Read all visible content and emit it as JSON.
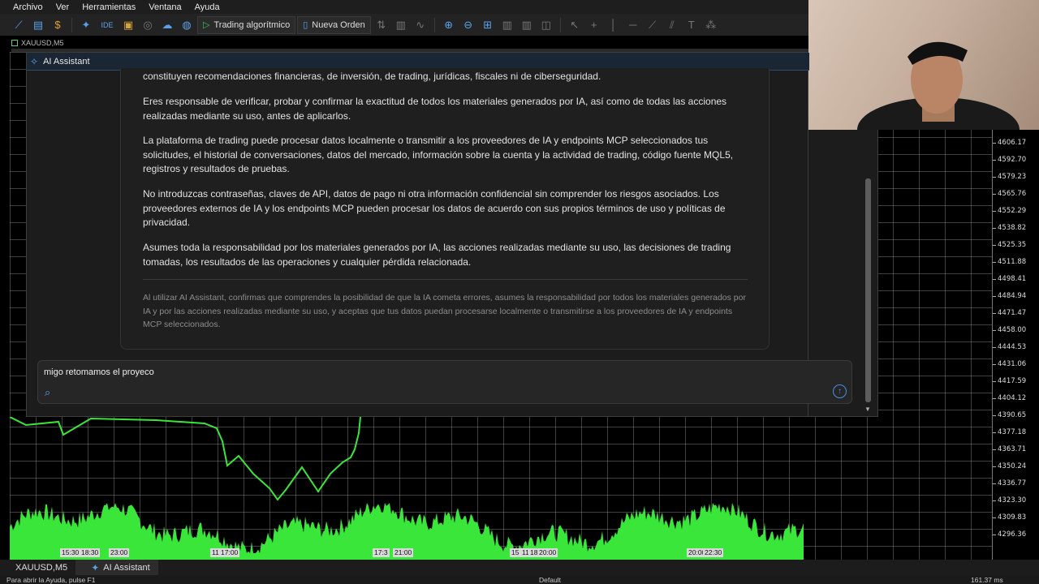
{
  "menu": [
    "Archivo",
    "Ver",
    "Herramientas",
    "Ventana",
    "Ayuda"
  ],
  "toolbar": {
    "algo_trading_label": "Trading algorítmico",
    "new_order_label": "Nueva Orden",
    "ide_label": "IDE"
  },
  "chart": {
    "symbol_tab": "XAUUSD,M5",
    "prices": [
      "4606.17",
      "4592.70",
      "4579.23",
      "4565.76",
      "4552.29",
      "4538.82",
      "4525.35",
      "4511.88",
      "4498.41",
      "4484.94",
      "4471.47",
      "4458.00",
      "4444.53",
      "4431.06",
      "4417.59",
      "4404.12",
      "4390.65",
      "4377.18",
      "4363.71",
      "4350.24",
      "4336.77",
      "4323.30",
      "4309.83",
      "4296.36"
    ],
    "time_labels": [
      "15:30",
      "18:30",
      "23:00",
      "11",
      "17:00",
      "17:3",
      "21:00",
      "15",
      "11",
      "18",
      "20:00",
      "20:00",
      "22:30"
    ]
  },
  "ai_assistant": {
    "title": "AI Assistant",
    "paragraphs": [
      "constituyen recomendaciones financieras, de inversión, de trading, jurídicas, fiscales ni de ciberseguridad.",
      "Eres responsable de verificar, probar y confirmar la exactitud de todos los materiales generados por IA, así como de todas las acciones realizadas mediante su uso, antes de aplicarlos.",
      "La plataforma de trading puede procesar datos localmente o transmitir a los proveedores de IA y endpoints MCP seleccionados tus solicitudes, el historial de conversaciones, datos del mercado, información sobre la cuenta y la actividad de trading, código fuente MQL5, registros y resultados de pruebas.",
      "No introduzcas contraseñas, claves de API, datos de pago ni otra información confidencial sin comprender los riesgos asociados. Los proveedores externos de IA y los endpoints MCP pueden procesar los datos de acuerdo con sus propios términos de uso y políticas de privacidad.",
      "Asumes toda la responsabilidad por los materiales generados por IA, las acciones realizadas mediante su uso, las decisiones de trading tomadas, los resultados de las operaciones y cualquier pérdida relacionada."
    ],
    "note": "Al utilizar AI Assistant, confirmas que comprendes la posibilidad de que la IA cometa errores, asumes la responsabilidad por todos los materiales generados por IA y por las acciones realizadas mediante su uso, y aceptas que tus datos puedan procesarse localmente o transmitirse a los proveedores de IA y endpoints MCP seleccionados.",
    "input_value": "migo retomamos el proyeco"
  },
  "bottom_tabs": [
    "XAUUSD,M5",
    "AI Assistant"
  ],
  "status": {
    "help": "Para abrir la Ayuda, pulse F1",
    "profile": "Default",
    "ping": "161.37 ms"
  },
  "colors": {
    "accent": "#4a90e2",
    "volume": "#39e639",
    "panel_bg": "#1c1c1c"
  }
}
